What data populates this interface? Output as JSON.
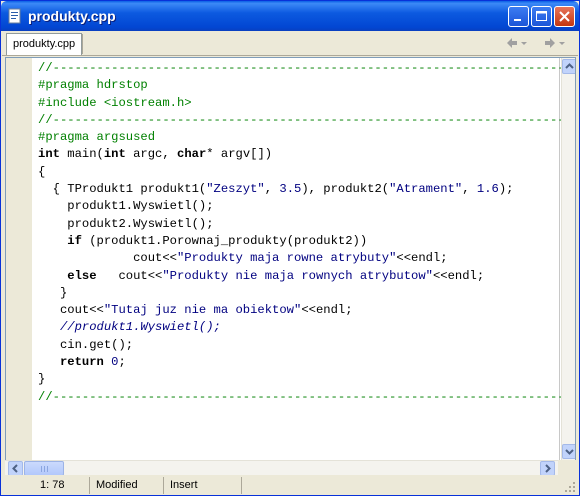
{
  "window": {
    "title": "produkty.cpp",
    "icon": "cpp-file-icon",
    "controls": [
      "minimize-icon",
      "maximize-icon",
      "close-icon"
    ]
  },
  "tabs": [
    {
      "label": "produkty.cpp",
      "active": true
    }
  ],
  "navigation": {
    "back_icon": "arrow-left-icon",
    "forward_icon": "arrow-right-icon"
  },
  "editor": {
    "language": "C++",
    "lines": [
      [
        {
          "t": "//-------------------------------------------------------------------------",
          "c": "pp"
        }
      ],
      [
        {
          "t": "#pragma hdrstop",
          "c": "pp"
        }
      ],
      [
        {
          "t": "#include <iostream.h>",
          "c": "pp"
        }
      ],
      [
        {
          "t": "//-------------------------------------------------------------------------",
          "c": "pp"
        }
      ],
      [
        {
          "t": "#pragma argsused",
          "c": "pp"
        }
      ],
      [
        {
          "t": "int",
          "c": "kw"
        },
        {
          "t": " main("
        },
        {
          "t": "int",
          "c": "kw"
        },
        {
          "t": " argc, "
        },
        {
          "t": "char",
          "c": "kw"
        },
        {
          "t": "* argv[])"
        }
      ],
      [
        {
          "t": "{"
        }
      ],
      [
        {
          "t": "  { TProdukt1 produkt1("
        },
        {
          "t": "\"Zeszyt\"",
          "c": "str"
        },
        {
          "t": ", "
        },
        {
          "t": "3.5",
          "c": "num"
        },
        {
          "t": "), produkt2("
        },
        {
          "t": "\"Atrament\"",
          "c": "str"
        },
        {
          "t": ", "
        },
        {
          "t": "1.6",
          "c": "num"
        },
        {
          "t": ");"
        }
      ],
      [
        {
          "t": "    produkt1.Wyswietl();"
        }
      ],
      [
        {
          "t": "    produkt2.Wyswietl();"
        }
      ],
      [
        {
          "t": "    "
        },
        {
          "t": "if",
          "c": "kw"
        },
        {
          "t": " (produkt1.Porownaj_produkty(produkt2))"
        }
      ],
      [
        {
          "t": "             cout<<"
        },
        {
          "t": "\"Produkty maja rowne atrybuty\"",
          "c": "str"
        },
        {
          "t": "<<endl;"
        }
      ],
      [
        {
          "t": "    "
        },
        {
          "t": "else",
          "c": "kw"
        },
        {
          "t": "   cout<<"
        },
        {
          "t": "\"Produkty nie maja rownych atrybutow\"",
          "c": "str"
        },
        {
          "t": "<<endl;"
        }
      ],
      [
        {
          "t": "   }"
        }
      ],
      [
        {
          "t": "   cout<<"
        },
        {
          "t": "\"Tutaj juz nie ma obiektow\"",
          "c": "str"
        },
        {
          "t": "<<endl;"
        }
      ],
      [
        {
          "t": "   "
        },
        {
          "t": "//produkt1.Wyswietl();",
          "c": "cm"
        }
      ],
      [
        {
          "t": "   cin.get();"
        }
      ],
      [
        {
          "t": "   "
        },
        {
          "t": "return",
          "c": "kw"
        },
        {
          "t": " "
        },
        {
          "t": "0",
          "c": "num"
        },
        {
          "t": ";"
        }
      ],
      [
        {
          "t": "}"
        }
      ],
      [
        {
          "t": "//-------------------------------------------------------------------------",
          "c": "pp"
        }
      ]
    ]
  },
  "status": {
    "position": "1: 78",
    "modified": "Modified",
    "mode": "Insert",
    "grip_icon": "resize-grip-icon"
  },
  "colors": {
    "titlebar": "#0246d2",
    "preprocessor": "#008000",
    "string": "#000080",
    "keyword": "#000000"
  }
}
